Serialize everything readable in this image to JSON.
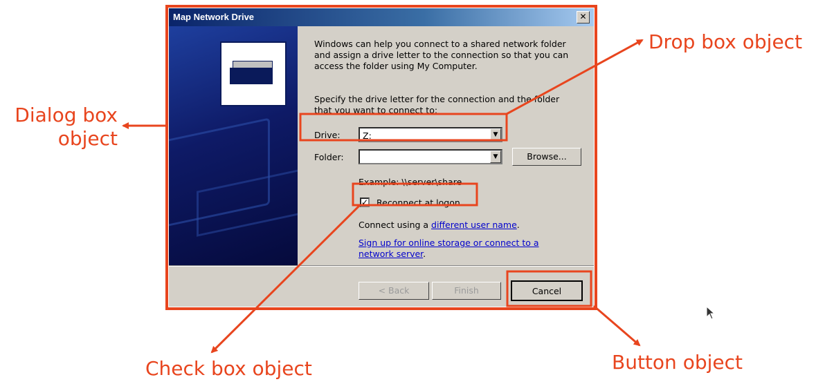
{
  "dialog": {
    "title": "Map Network Drive",
    "close_glyph": "✕",
    "intro": "Windows can help you connect to a shared network folder and assign a drive letter to the connection so that you can access the folder using My Computer.",
    "specify": "Specify the drive letter for the connection and the folder that you want to connect to:",
    "drive_label": "Drive:",
    "drive_value": "Z:",
    "folder_label": "Folder:",
    "folder_value": "",
    "browse_label": "Browse...",
    "example": "Example: \\\\server\\share",
    "reconnect_label": "Reconnect at logon",
    "reconnect_checked": true,
    "check_glyph": "✓",
    "dropdown_glyph": "▼",
    "connect_prefix": "Connect using a ",
    "connect_link": "different user name",
    "connect_suffix": ".",
    "signup_link": "Sign up for online storage or connect to a network server",
    "signup_suffix": ".",
    "back_label": "< Back",
    "finish_label": "Finish",
    "cancel_label": "Cancel"
  },
  "annotations": {
    "dialog_box": "Dialog box object",
    "drop_box": "Drop box object",
    "check_box": "Check box object",
    "button": "Button object"
  },
  "colors": {
    "annotation": "#e8451e",
    "dialog_face": "#d4d0c8",
    "titlebar": "#0a246a",
    "link": "#0000cc"
  },
  "icons": [
    "close-icon",
    "network-drive-icon",
    "dropdown-arrow-icon",
    "checkmark-icon",
    "mouse-cursor-icon"
  ]
}
